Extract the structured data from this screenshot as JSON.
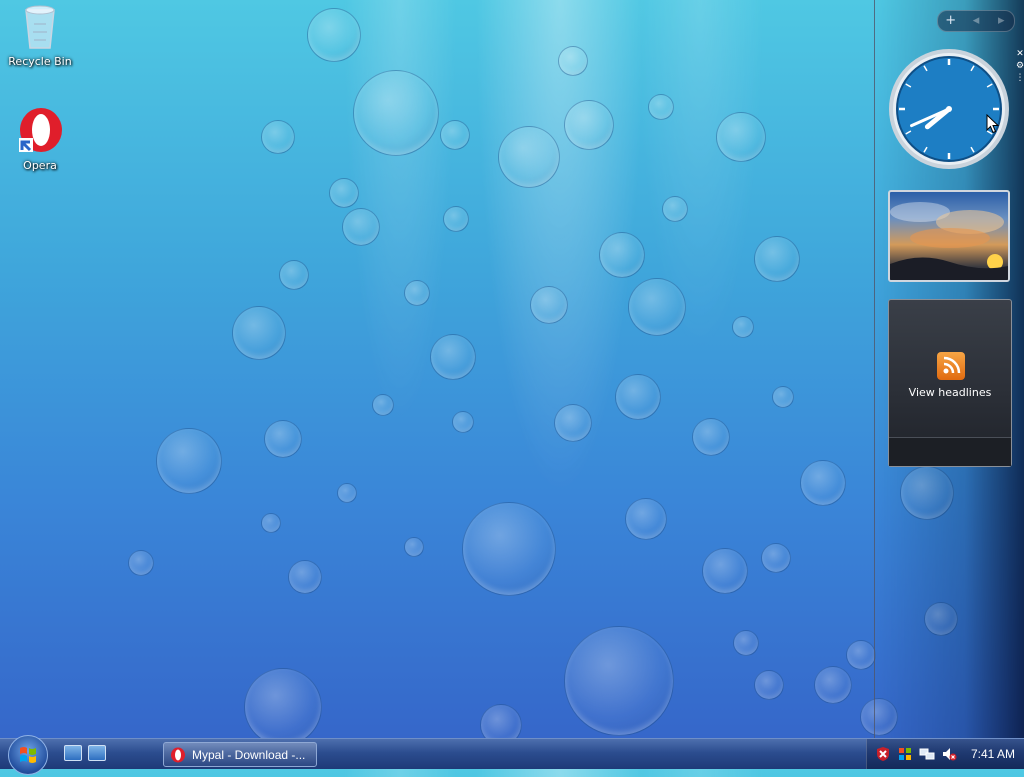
{
  "desktop": {
    "icons": [
      {
        "label": "Recycle Bin"
      },
      {
        "label": "Opera"
      }
    ]
  },
  "sidebar": {
    "controls": {
      "add": "+",
      "prev": "◂",
      "next": "▸"
    },
    "feed": {
      "view_label": "View headlines"
    },
    "clock": {
      "hour": 7,
      "minute": 41
    }
  },
  "taskbar": {
    "task_label": "Mypal - Download -...",
    "clock": "7:41 AM"
  },
  "icons": {
    "start": "windows-orb-icon",
    "show_desktop": "show-desktop-icon",
    "switch_windows": "switch-windows-icon",
    "opera": "opera-icon",
    "security": "windows-security-alert-icon",
    "network": "network-icon",
    "volume": "volume-muted-icon"
  },
  "colors": {
    "taskbar": "#2c4d8f",
    "opera_red": "#e01e2b",
    "rss_orange": "#f08a24"
  }
}
